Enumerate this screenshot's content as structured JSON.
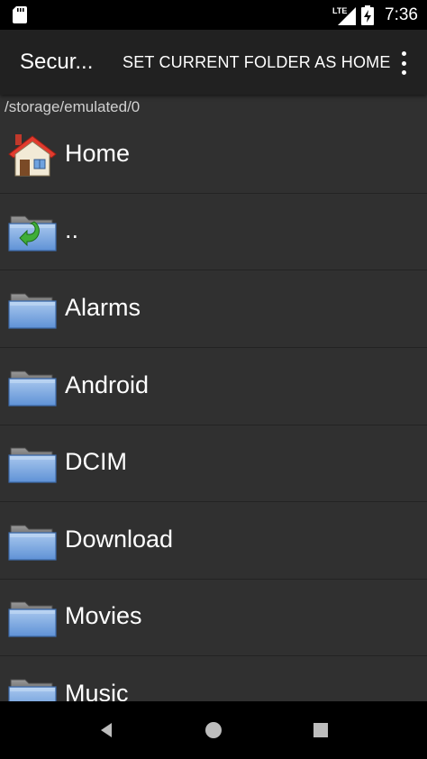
{
  "status_bar": {
    "network": "LTE",
    "time": "7:36",
    "icons": [
      "sd-card-icon",
      "signal-icon",
      "battery-charging-icon"
    ]
  },
  "app_bar": {
    "title": "Secur...",
    "action_label": "SET CURRENT FOLDER AS HOME",
    "overflow_icon": "more-vert-icon"
  },
  "current_path": "/storage/emulated/0",
  "items": [
    {
      "label": "Home",
      "icon": "home-icon"
    },
    {
      "label": "..",
      "icon": "folder-up-icon"
    },
    {
      "label": "Alarms",
      "icon": "folder-icon"
    },
    {
      "label": "Android",
      "icon": "folder-icon"
    },
    {
      "label": "DCIM",
      "icon": "folder-icon"
    },
    {
      "label": "Download",
      "icon": "folder-icon"
    },
    {
      "label": "Movies",
      "icon": "folder-icon"
    },
    {
      "label": "Music",
      "icon": "folder-icon"
    }
  ],
  "nav_bar": {
    "back": "back-icon",
    "home": "home-circle-icon",
    "recents": "recents-icon"
  }
}
